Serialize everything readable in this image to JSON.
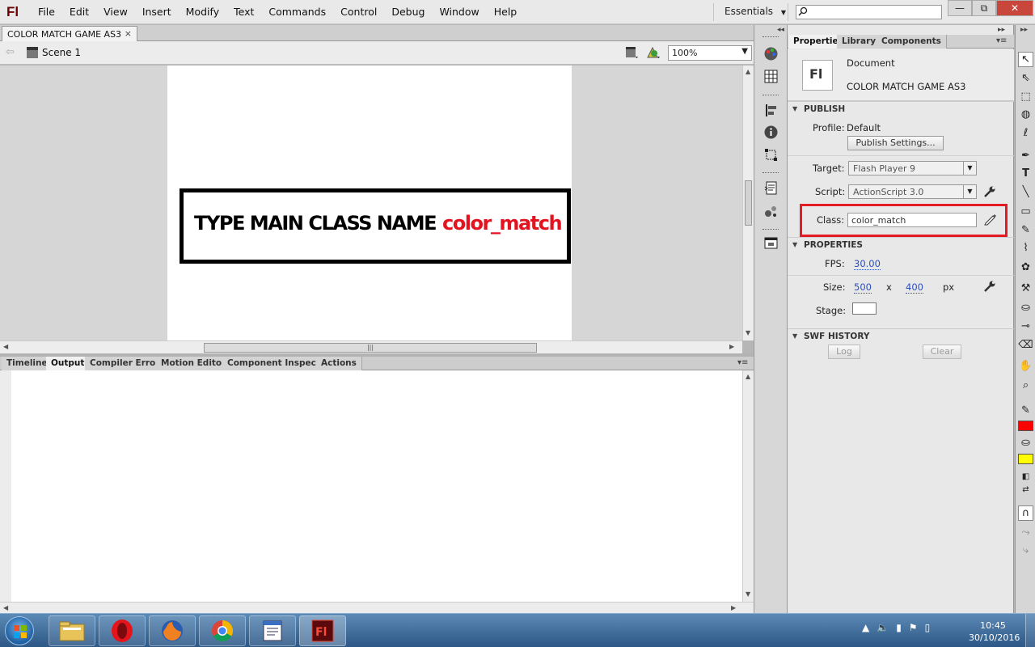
{
  "app": {
    "logo": "Fl",
    "menu": [
      "File",
      "Edit",
      "View",
      "Insert",
      "Modify",
      "Text",
      "Commands",
      "Control",
      "Debug",
      "Window",
      "Help"
    ],
    "workspace": "Essentials",
    "window_buttons": [
      "—",
      "⧉",
      "✕"
    ]
  },
  "document": {
    "tab_label": "COLOR MATCH GAME AS3",
    "tab_close": "×",
    "scene": "Scene 1",
    "zoom": "100%"
  },
  "stage": {
    "banner_text": "TYPE MAIN CLASS NAME",
    "banner_class": "color_match",
    "banner_text_color": "#000000",
    "banner_class_color": "#e2141f"
  },
  "bottom_panel": {
    "tabs": [
      "Timeline",
      "Output",
      "Compiler Errors",
      "Motion Editor",
      "Component Inspector",
      "Actions"
    ],
    "active_tab": "Output"
  },
  "properties": {
    "tabs": [
      "Properties",
      "Library",
      "Components"
    ],
    "active_tab": "Properties",
    "doc_icon": "Fl",
    "doc_type": "Document",
    "doc_name": "COLOR MATCH GAME AS3",
    "publish": {
      "header": "PUBLISH",
      "profile_label": "Profile:",
      "profile_value": "Default",
      "publish_settings_button": "Publish Settings...",
      "target_label": "Target:",
      "target_value": "Flash Player 9",
      "script_label": "Script:",
      "script_value": "ActionScript 3.0",
      "class_label": "Class:",
      "class_value": "color_match"
    },
    "doc_properties": {
      "header": "PROPERTIES",
      "fps_label": "FPS:",
      "fps_value": "30.00",
      "size_label": "Size:",
      "width": "500",
      "x_sep": "x",
      "height": "400",
      "unit": "px",
      "stage_label": "Stage:",
      "stage_color": "#ffffff"
    },
    "swf_history": {
      "header": "SWF HISTORY",
      "log_button": "Log",
      "clear_button": "Clear"
    }
  },
  "tools": {
    "stroke_color": "#ff0000",
    "fill_color": "#ffff00"
  },
  "taskbar": {
    "apps": [
      "file-explorer",
      "opera",
      "firefox",
      "chrome",
      "text-editor",
      "flash"
    ],
    "active_app": "flash",
    "time": "10:45",
    "date": "30/10/2016"
  }
}
